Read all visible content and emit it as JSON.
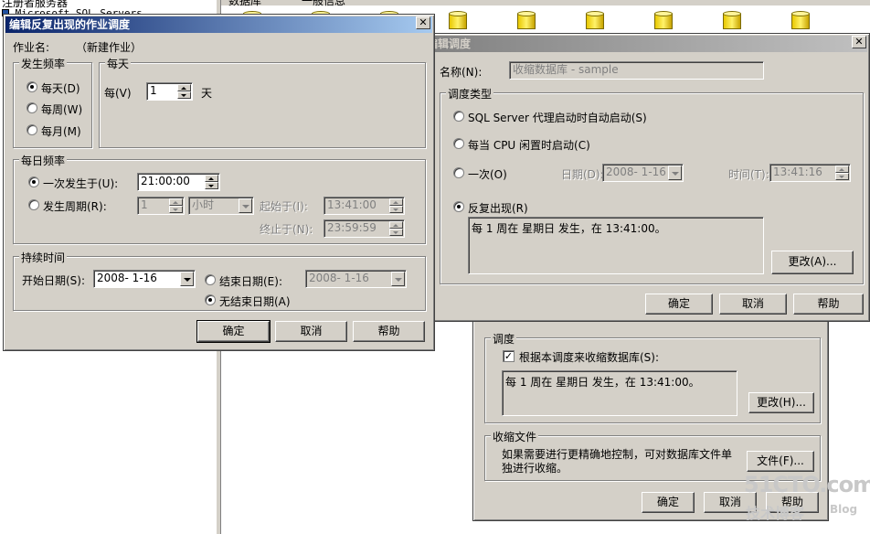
{
  "background": {
    "tree_line1": "注册者服务器",
    "tree_line2": "Microsoft SQL Servers",
    "top_cols": [
      "数据库",
      "一般信息"
    ]
  },
  "dialog1": {
    "title": "编辑反复出现的作业调度",
    "job_name_label": "作业名:",
    "job_name_value": "（新建作业）",
    "freq_group": "发生频率",
    "freq_options": [
      "每天(D)",
      "每周(W)",
      "每月(M)"
    ],
    "daily_group": "每天",
    "every_label": "每(V)",
    "every_value": "1",
    "every_unit": "天",
    "dayfreq_group": "每日频率",
    "once_label": "一次发生于(U):",
    "once_time": "21:00:00",
    "period_label": "发生周期(R):",
    "period_value": "1",
    "period_unit": "小时",
    "start_at_label": "起始于(I):",
    "start_at_value": "13:41:00",
    "end_at_label": "终止于(N):",
    "end_at_value": "23:59:59",
    "duration_group": "持续时间",
    "start_date_label": "开始日期(S):",
    "start_date_value": "2008- 1-16",
    "end_date_label": "结束日期(E):",
    "end_date_value": "2008- 1-16",
    "no_end_label": "无结束日期(A)",
    "ok": "确定",
    "cancel": "取消",
    "help": "帮助"
  },
  "dialog2": {
    "title": "编辑调度",
    "name_label": "名称(N):",
    "name_value": "收缩数据库 - sample",
    "type_group": "调度类型",
    "opt_agent": "SQL Server 代理启动时自动启动(S)",
    "opt_idle": "每当 CPU 闲置时启动(C)",
    "opt_once": "一次(O)",
    "date_label": "日期(D):",
    "date_value": "2008- 1-16",
    "time_label": "时间(T):",
    "time_value": "13:41:16",
    "opt_recurring": "反复出现(R)",
    "recurring_desc": "每 1 周在 星期日 发生，在 13:41:00。",
    "change": "更改(A)...",
    "ok": "确定",
    "cancel": "取消",
    "help": "帮助"
  },
  "dialog3": {
    "sched_group": "调度",
    "check_label": "根据本调度来收缩数据库(S):",
    "desc": "每 1 周在 星期日 发生，在 13:41:00。",
    "change": "更改(H)...",
    "files_group": "收缩文件",
    "files_text": "如果需要进行更精确地控制，可对数据库文件单独进行收缩。",
    "files_btn": "文件(F)...",
    "ok": "确定",
    "cancel": "取消",
    "help": "帮助"
  },
  "watermark": {
    "site": "51CTO.com",
    "sub": "技术博客",
    "blog": "Blog"
  }
}
